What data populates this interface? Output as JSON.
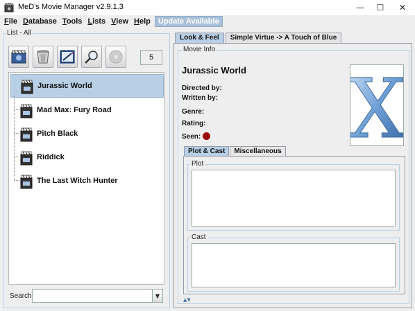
{
  "window": {
    "title": "MeD's Movie Manager v2.9.1.3",
    "minimize": "—",
    "maximize": "☐",
    "close": "✕"
  },
  "menubar": {
    "items": [
      {
        "label": "File",
        "mnemonic": "F",
        "rest": "ile"
      },
      {
        "label": "Database",
        "mnemonic": "D",
        "rest": "atabase"
      },
      {
        "label": "Tools",
        "mnemonic": "T",
        "rest": "ools"
      },
      {
        "label": "Lists",
        "mnemonic": "L",
        "rest": "ists"
      },
      {
        "label": "View",
        "mnemonic": "V",
        "rest": "iew"
      },
      {
        "label": "Help",
        "mnemonic": "H",
        "rest": "elp"
      }
    ],
    "update_label": "Update Available"
  },
  "list_panel": {
    "legend": "List - All",
    "toolbar": {
      "icons": [
        "add-movie-icon",
        "delete-icon",
        "edit-icon",
        "search-icon",
        "disc-icon"
      ],
      "count": "5"
    },
    "movies": [
      {
        "title": "Jurassic World",
        "selected": true
      },
      {
        "title": "Mad Max: Fury Road",
        "selected": false
      },
      {
        "title": "Pitch Black",
        "selected": false
      },
      {
        "title": "Riddick",
        "selected": false
      },
      {
        "title": "The Last Witch Hunter",
        "selected": false
      }
    ],
    "search_label": "Search",
    "search_value": ""
  },
  "right_tabs": [
    {
      "label": "Look & Feel",
      "active": true
    },
    {
      "label": "Simple Virtue -> A Touch of Blue",
      "active": false
    }
  ],
  "movie_info": {
    "legend": "Movie Info",
    "title": "Jurassic World",
    "directed_by_label": "Directed by:",
    "written_by_label": "Written by:",
    "genre_label": "Genre:",
    "rating_label": "Rating:",
    "seen_label": "Seen:",
    "seen_color": "#990000",
    "cover_letter": "X"
  },
  "sub_tabs": [
    {
      "label": "Plot & Cast",
      "active": true
    },
    {
      "label": "Miscellaneous",
      "active": false
    }
  ],
  "plot": {
    "legend": "Plot",
    "text": ""
  },
  "cast": {
    "legend": "Cast",
    "text": ""
  },
  "colors": {
    "accent": "#b8cfe5",
    "selected_row": "#b8cfe5",
    "update_button": "#a8c0d8",
    "seen_dot": "#990000"
  }
}
